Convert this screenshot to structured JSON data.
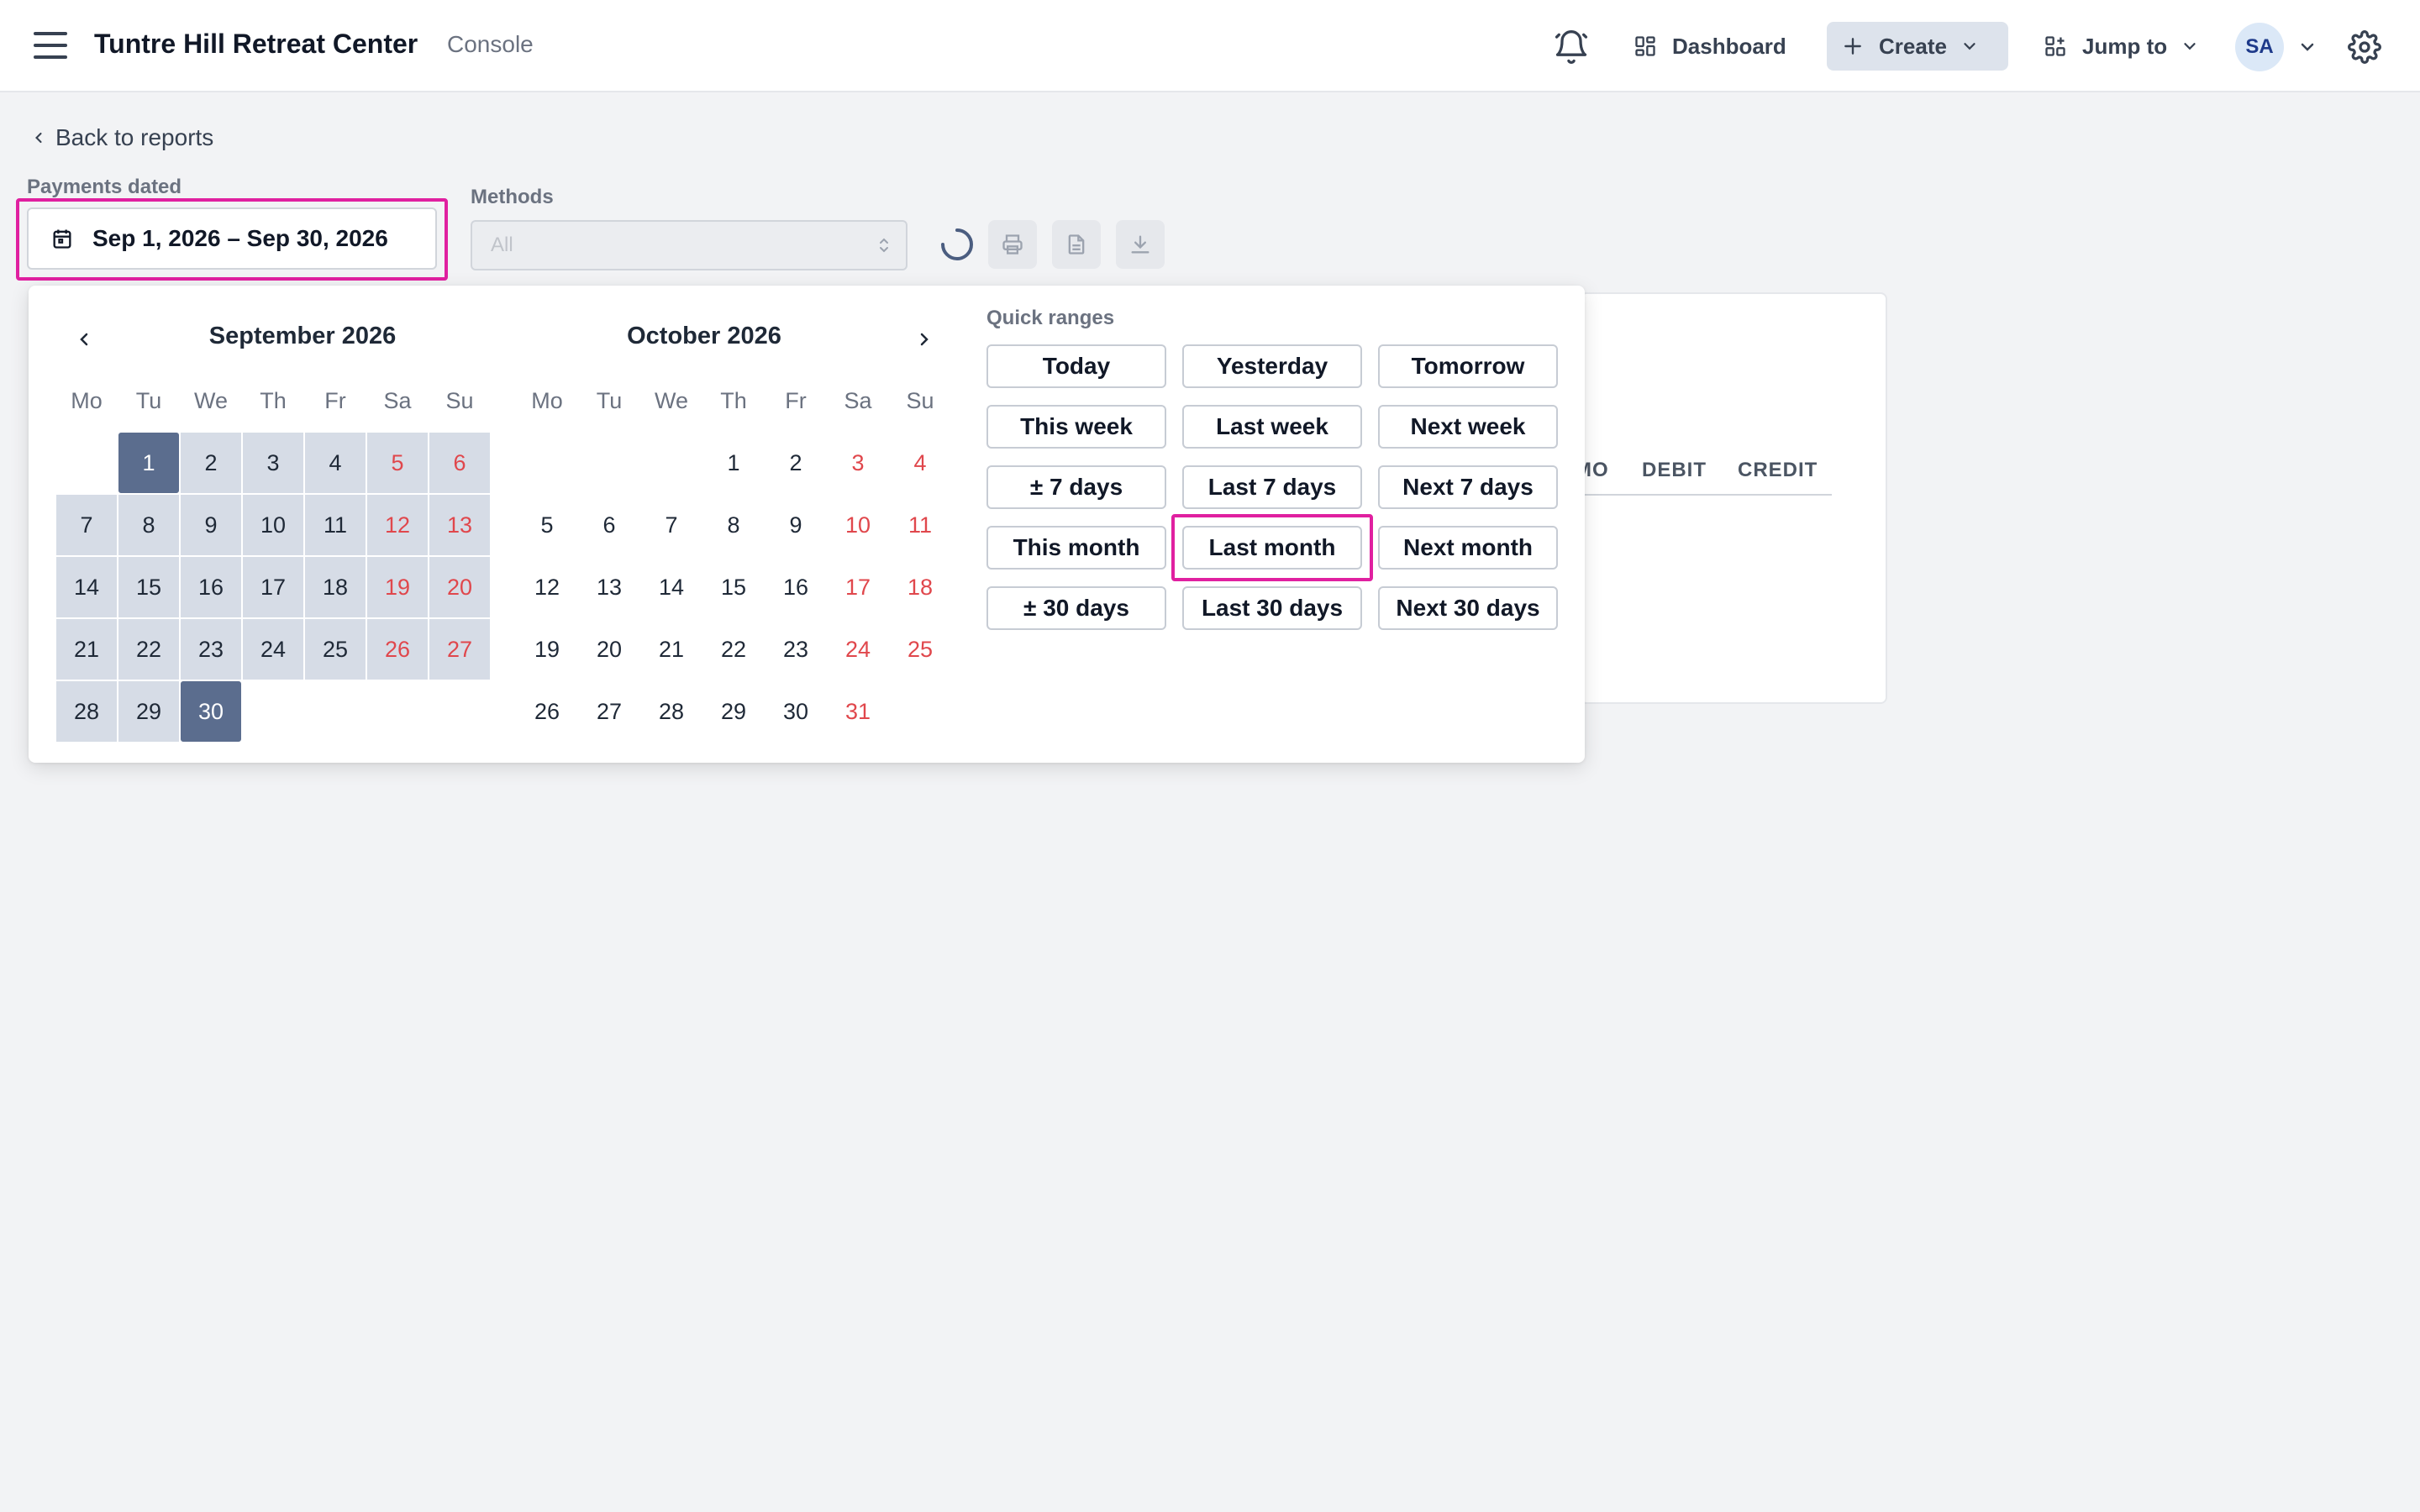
{
  "header": {
    "title": "Tuntre Hill Retreat Center",
    "subtitle": "Console",
    "dashboard_label": "Dashboard",
    "create_label": "Create",
    "jump_label": "Jump to",
    "avatar_initials": "SA"
  },
  "back_link": "Back to reports",
  "filters": {
    "payments_label": "Payments dated",
    "date_range": "Sep 1, 2026 – Sep 30, 2026",
    "methods_label": "Methods",
    "methods_placeholder": "All"
  },
  "report_table": {
    "columns": [
      "MO",
      "DEBIT",
      "CREDIT"
    ]
  },
  "datepicker": {
    "weekdays": [
      "Mo",
      "Tu",
      "We",
      "Th",
      "Fr",
      "Sa",
      "Su"
    ],
    "months": [
      {
        "title": "September 2026",
        "leading_blanks": 1,
        "days": 30,
        "range_start": 1,
        "range_end": 30
      },
      {
        "title": "October 2026",
        "leading_blanks": 3,
        "days": 31,
        "range_start": null,
        "range_end": null
      }
    ],
    "quick_ranges_label": "Quick ranges",
    "quick_ranges": [
      "Today",
      "Yesterday",
      "Tomorrow",
      "This week",
      "Last week",
      "Next week",
      "± 7 days",
      "Last 7 days",
      "Next 7 days",
      "This month",
      "Last month",
      "Next month",
      "± 30 days",
      "Last 30 days",
      "Next 30 days"
    ],
    "highlighted_quick_range": "Last month"
  },
  "colors": {
    "accent_highlight": "#e020a0",
    "range_fill": "#d6dce6",
    "range_edge": "#5b6d8e",
    "weekend_text": "#e0474c"
  }
}
